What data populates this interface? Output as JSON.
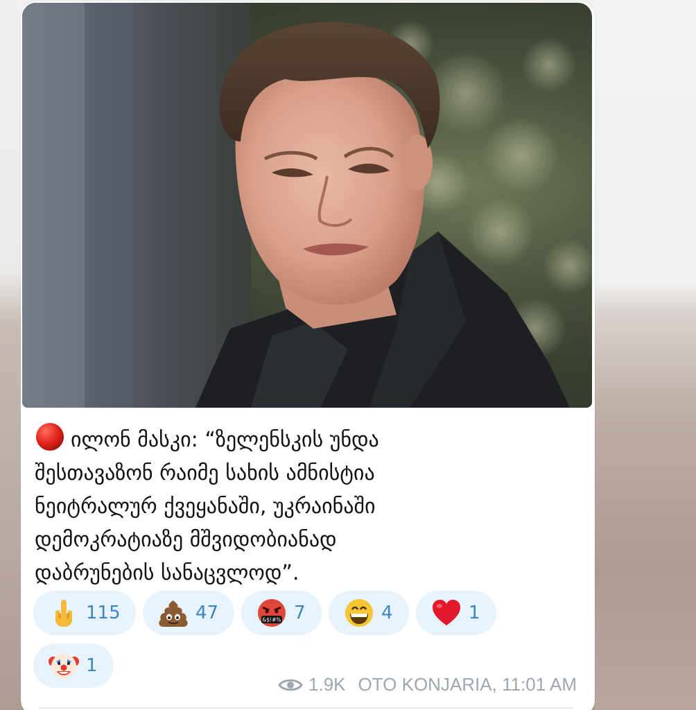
{
  "post": {
    "image_alt": "Photo of Elon Musk",
    "status_icon": "red-circle-icon",
    "text": "ილონ მასკი: “ზელენსკის უნდა\nშესთავაზონ რაიმე სახის ამნისტია\nნეიტრალურ ქვეყანაში, უკრაინაში\nდემოკრატიაზე მშვიდობიანად\nდაბრუნების სანაცვლოდ”.",
    "reactions": [
      {
        "emoji": "middle-finger-emoji",
        "count": "115"
      },
      {
        "emoji": "poop-emoji",
        "count": "47"
      },
      {
        "emoji": "cursing-face-emoji",
        "count": "7"
      },
      {
        "emoji": "grinning-face-emoji",
        "count": "4"
      },
      {
        "emoji": "red-heart-emoji",
        "count": "1"
      },
      {
        "emoji": "clown-face-emoji",
        "count": "1"
      }
    ],
    "views": "1.9K",
    "author": "OTO KONJARIA",
    "time": "11:01 AM",
    "author_time": "OTO KONJARIA, 11:01 AM"
  },
  "colors": {
    "reaction_bg": "#e8f2fb",
    "reaction_count": "#3a85c2",
    "meta": "#9ea7b0"
  }
}
